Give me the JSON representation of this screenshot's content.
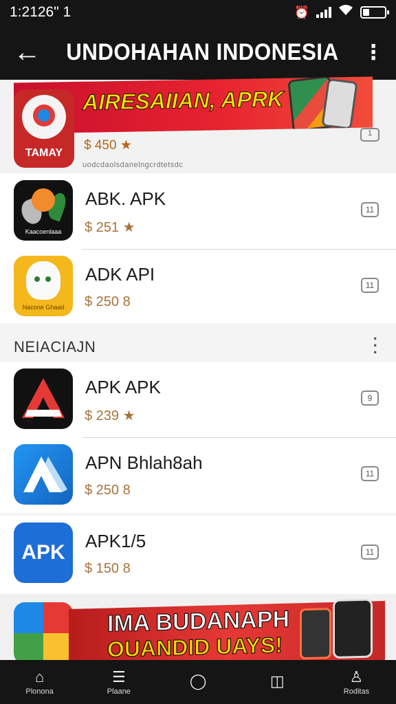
{
  "status_bar": {
    "time": "1:2126\" 1",
    "battery_level": 0.3
  },
  "app_bar": {
    "back_icon": "←",
    "title": "UNDOHAHAN INDONESIA",
    "more_icon": "⋮"
  },
  "featured": {
    "banner_text": "AIRESAIIAN, APRK",
    "icon_label": "TAMAY",
    "price": "$ 450 ★",
    "subtitle": "uodcdaolsdanelngcrdtetsdc",
    "button": "1"
  },
  "group1": [
    {
      "title": "ABK. APK",
      "price": "$ 251 ★",
      "button": "11",
      "icon": "bird-app-icon",
      "icon_label": "Kaacoenlaaa"
    },
    {
      "title": "ADK API",
      "price": "$ 250 8",
      "button": "11",
      "icon": "cat-app-icon",
      "icon_label": "Nacone Ghaad"
    }
  ],
  "section": {
    "title": "NEIACIAJN",
    "more": "⋮"
  },
  "group2": [
    {
      "title": "APK APK",
      "price": "$ 239 ★",
      "button": "9",
      "icon": "a-logo-icon"
    },
    {
      "title": "APN Bhlah8ah",
      "price": "$ 250 8",
      "button": "11",
      "icon": "delta-logo-icon"
    }
  ],
  "group3": [
    {
      "title": "APK1/5",
      "price": "$ 150 8",
      "button": "11",
      "icon": "apk-icon",
      "icon_text": "APK"
    }
  ],
  "bottom_banner": {
    "line1": "IMA BUDANAPH",
    "line2": "OUANDID UAYS!"
  },
  "nav": [
    {
      "icon": "⌂",
      "label": "Plonona"
    },
    {
      "icon": "☰",
      "label": "Plaane"
    },
    {
      "icon": "◯",
      "label": ""
    },
    {
      "icon": "◫",
      "label": ""
    },
    {
      "icon": "♙",
      "label": "Roditas"
    }
  ]
}
